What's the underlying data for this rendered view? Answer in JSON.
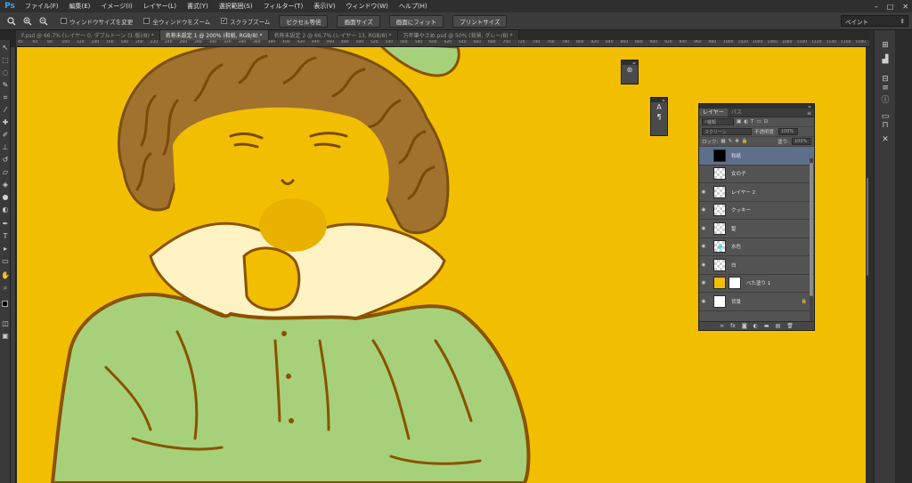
{
  "app": {
    "logo": "Ps"
  },
  "menu": [
    "ファイル(F)",
    "編集(E)",
    "イメージ(I)",
    "レイヤー(L)",
    "書式(Y)",
    "選択範囲(S)",
    "フィルター(T)",
    "表示(V)",
    "ウィンドウ(W)",
    "ヘルプ(H)"
  ],
  "window_controls": {
    "minimize": "–",
    "maximize": "□",
    "close": "✕"
  },
  "options": {
    "tool_icon": "zoom-icon",
    "resize_windows_label": "ウィンドウサイズを変更",
    "zoom_all_label": "全ウィンドウをズーム",
    "scrubby_zoom_label": "スクラブズーム",
    "scrubby_zoom_checked": true,
    "actual_pixels_btn": "ピクセル等倍",
    "fit_screen_btn": "画面サイズ",
    "fill_screen_btn": "画面にフィット",
    "print_size_btn": "プリントサイズ",
    "workspace": "ペイント"
  },
  "tabs": [
    {
      "label": "F.psd @ 66.7% (レイヤー 0, ダブルトーン (1 版)/8) *",
      "active": false
    },
    {
      "label": "名称未設定 1 @ 200% (和紙, RGB/8) *",
      "active": true
    },
    {
      "label": "名称未設定 2 @ 66.7% (レイヤー 13, RGB/8) *",
      "active": false
    },
    {
      "label": "万年筆やさめ.psd @ 50% (背景, グレー/8) *",
      "active": false
    }
  ],
  "ruler": [
    "40",
    "60",
    "80",
    "100",
    "120",
    "140",
    "160",
    "180",
    "200",
    "220",
    "240",
    "260",
    "280",
    "300",
    "320",
    "340",
    "360",
    "380",
    "400",
    "420",
    "440",
    "460",
    "480",
    "500",
    "520",
    "540",
    "560",
    "580",
    "600",
    "620",
    "640",
    "660",
    "680",
    "700",
    "720",
    "740",
    "760",
    "780",
    "800",
    "820",
    "840",
    "860",
    "880",
    "900",
    "920",
    "940",
    "960",
    "980",
    "1000",
    "1020",
    "1040",
    "1060",
    "1080",
    "1100",
    "1120",
    "1140",
    "1160",
    "1180"
  ],
  "layers_panel": {
    "tab_layers": "レイヤー",
    "tab_paths": "パス",
    "kind_filter": "種類",
    "blend_mode": "スクリーン",
    "opacity_label": "不透明度:",
    "opacity_value": "100%",
    "lock_label": "ロック:",
    "fill_label": "塗り:",
    "fill_value": "100%",
    "layers": [
      {
        "name": "和紙",
        "thumb": "black",
        "selected": true,
        "visible": false
      },
      {
        "name": "女の子",
        "thumb": "checker",
        "selected": false,
        "visible": false
      },
      {
        "name": "レイヤー 2",
        "thumb": "checker",
        "selected": false,
        "visible": true
      },
      {
        "name": "クッキー",
        "thumb": "checker",
        "selected": false,
        "visible": true
      },
      {
        "name": "髪",
        "thumb": "checker",
        "selected": false,
        "visible": true
      },
      {
        "name": "水色",
        "thumb": "cyan-dot",
        "selected": false,
        "visible": true
      },
      {
        "name": "白",
        "thumb": "checker",
        "selected": false,
        "visible": true
      },
      {
        "name": "べた塗り 1",
        "thumb": "yellow",
        "selected": false,
        "visible": true,
        "mask": true
      },
      {
        "name": "背景",
        "thumb": "white",
        "selected": false,
        "visible": true
      }
    ]
  },
  "colors": {
    "canvas_bg": "#f2be00",
    "hair": "#a0722e",
    "outline": "#8a5200",
    "dress": "#a6d17a",
    "collar": "#fff3c4",
    "cookie": "#e9b100"
  }
}
